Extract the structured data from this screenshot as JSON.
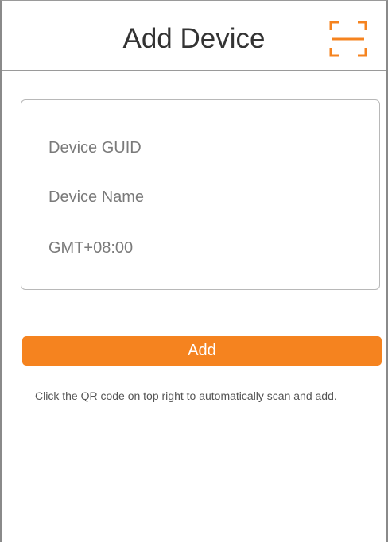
{
  "header": {
    "title": "Add Device",
    "scan_icon": "qr-scan-icon"
  },
  "form": {
    "device_guid": {
      "value": "",
      "placeholder": "Device GUID"
    },
    "device_name": {
      "value": "",
      "placeholder": "Device Name"
    },
    "timezone": {
      "value": "GMT+08:00"
    }
  },
  "actions": {
    "add_label": "Add"
  },
  "hint": {
    "text": "Click the QR code on top right to automatically scan and add."
  },
  "colors": {
    "accent": "#f5831f",
    "text_muted": "#7a7a7a",
    "border": "#b8b8b8"
  }
}
